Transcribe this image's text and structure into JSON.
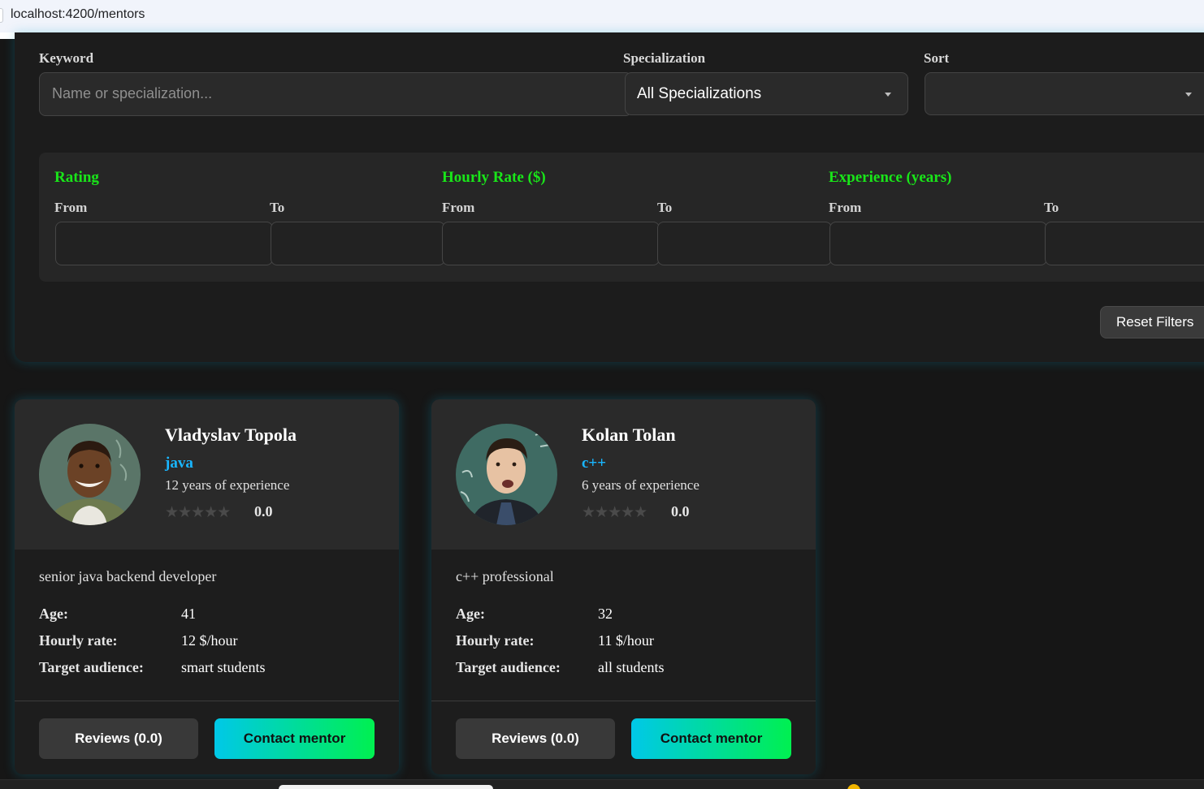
{
  "browser": {
    "url": "localhost:4200/mentors"
  },
  "filters": {
    "keyword_label": "Keyword",
    "keyword_placeholder": "Name or specialization...",
    "specialization_label": "Specialization",
    "specialization_value": "All Specializations",
    "sort_label": "Sort",
    "sort_value": "",
    "rating": {
      "title": "Rating",
      "from_label": "From",
      "to_label": "To",
      "from_value": "",
      "to_value": ""
    },
    "hourly_rate": {
      "title": "Hourly Rate ($)",
      "from_label": "From",
      "to_label": "To",
      "from_value": "",
      "to_value": ""
    },
    "experience": {
      "title": "Experience (years)",
      "from_label": "From",
      "to_label": "To",
      "from_value": "",
      "to_value": ""
    },
    "reset_label": "Reset Filters"
  },
  "labels": {
    "age": "Age:",
    "hourly_rate": "Hourly rate:",
    "target_audience": "Target audience:"
  },
  "mentors": [
    {
      "name": "Vladyslav Topola",
      "specialization": "java",
      "experience": "12 years of experience",
      "stars": "★★★★★",
      "rating": "0.0",
      "rating_value": 0,
      "description": "senior java backend developer",
      "age": "41",
      "hourly_rate": "12 $/hour",
      "target_audience": "smart students",
      "reviews_label": "Reviews (0.0)",
      "contact_label": "Contact mentor"
    },
    {
      "name": "Kolan Tolan",
      "specialization": "c++",
      "experience": "6 years of experience",
      "stars": "★★★★★",
      "rating": "0.0",
      "rating_value": 0,
      "description": "c++ professional",
      "age": "32",
      "hourly_rate": "11 $/hour",
      "target_audience": "all students",
      "reviews_label": "Reviews (0.0)",
      "contact_label": "Contact mentor"
    }
  ],
  "colors": {
    "accent_green": "#19e619",
    "spec_blue": "#19b6ff",
    "contact_gradient_start": "#00c8e8",
    "contact_gradient_end": "#00f050",
    "background": "#161616"
  }
}
